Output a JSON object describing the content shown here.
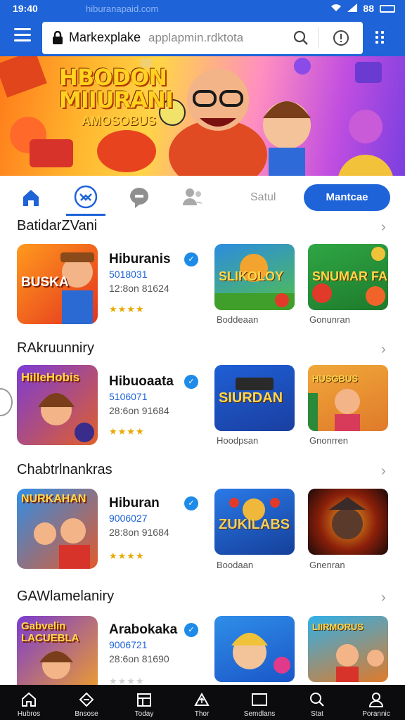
{
  "status_bar": {
    "time": "19:40",
    "url_hint": "hiburanapaid.com",
    "battery": "88"
  },
  "search": {
    "brand": "Markexplake",
    "url": "applapmin.rdktota"
  },
  "banner": {
    "title_line1": "HBODON",
    "title_line2": "MIIURANI",
    "subtitle": "AMOSOBUS"
  },
  "tabs": {
    "text_tab": "Satul",
    "cta_label": "Mantcae"
  },
  "sections": [
    {
      "title": "BatidarZVani",
      "featured": {
        "badge": "BUSKA",
        "name": "Hiburanis",
        "code": "5018031",
        "size": "12:8on 81624",
        "rating": "★★★★"
      },
      "tiles": [
        {
          "art": "SLIKOLOY",
          "caption": "Boddeaan"
        },
        {
          "art": "SNUMAR FARMS",
          "caption": "Gonunran"
        }
      ]
    },
    {
      "title": "RAkruunniry",
      "featured": {
        "badge": "HilleHobis",
        "name": "Hibuoaata",
        "code": "5106071",
        "size": "28:6on 91684",
        "rating": "★★★★"
      },
      "tiles": [
        {
          "art": "SIURDAN",
          "caption": "Hoodpsan"
        },
        {
          "art": "HUSGBUS",
          "caption": "Gnonrren"
        }
      ]
    },
    {
      "title": "Chabtrlnankras",
      "featured": {
        "badge": "NURKAHAN",
        "name": "Hiburan",
        "code": "9006027",
        "size": "28:8on 91684",
        "rating": "★★★★"
      },
      "tiles": [
        {
          "art": "ZUKILABS",
          "caption": "Boodaan"
        },
        {
          "art": "",
          "caption": "Gnenran"
        }
      ]
    },
    {
      "title": "GAWlamelaniry",
      "featured": {
        "badge": "Gabvelin LACUEBLA",
        "name": "Arabokaka",
        "code": "9006721",
        "size": "28:6on 81690",
        "rating": "★★★★"
      },
      "tiles": [
        {
          "art": "",
          "caption": ""
        },
        {
          "art": "LIIRMORUS",
          "caption": ""
        }
      ]
    }
  ],
  "bottom_nav": [
    {
      "label": "Hubros",
      "icon": "home-icon"
    },
    {
      "label": "Bnsose",
      "icon": "store-icon"
    },
    {
      "label": "Today",
      "icon": "calendar-icon"
    },
    {
      "label": "Thor",
      "icon": "upload-icon"
    },
    {
      "label": "Semdlans",
      "icon": "window-icon"
    },
    {
      "label": "Stat",
      "icon": "search-icon"
    },
    {
      "label": "Porannic",
      "icon": "profile-icon"
    }
  ],
  "colors": {
    "accent": "#1e63d8",
    "star": "#e8a800",
    "nav_bg": "#0c0c0e"
  }
}
